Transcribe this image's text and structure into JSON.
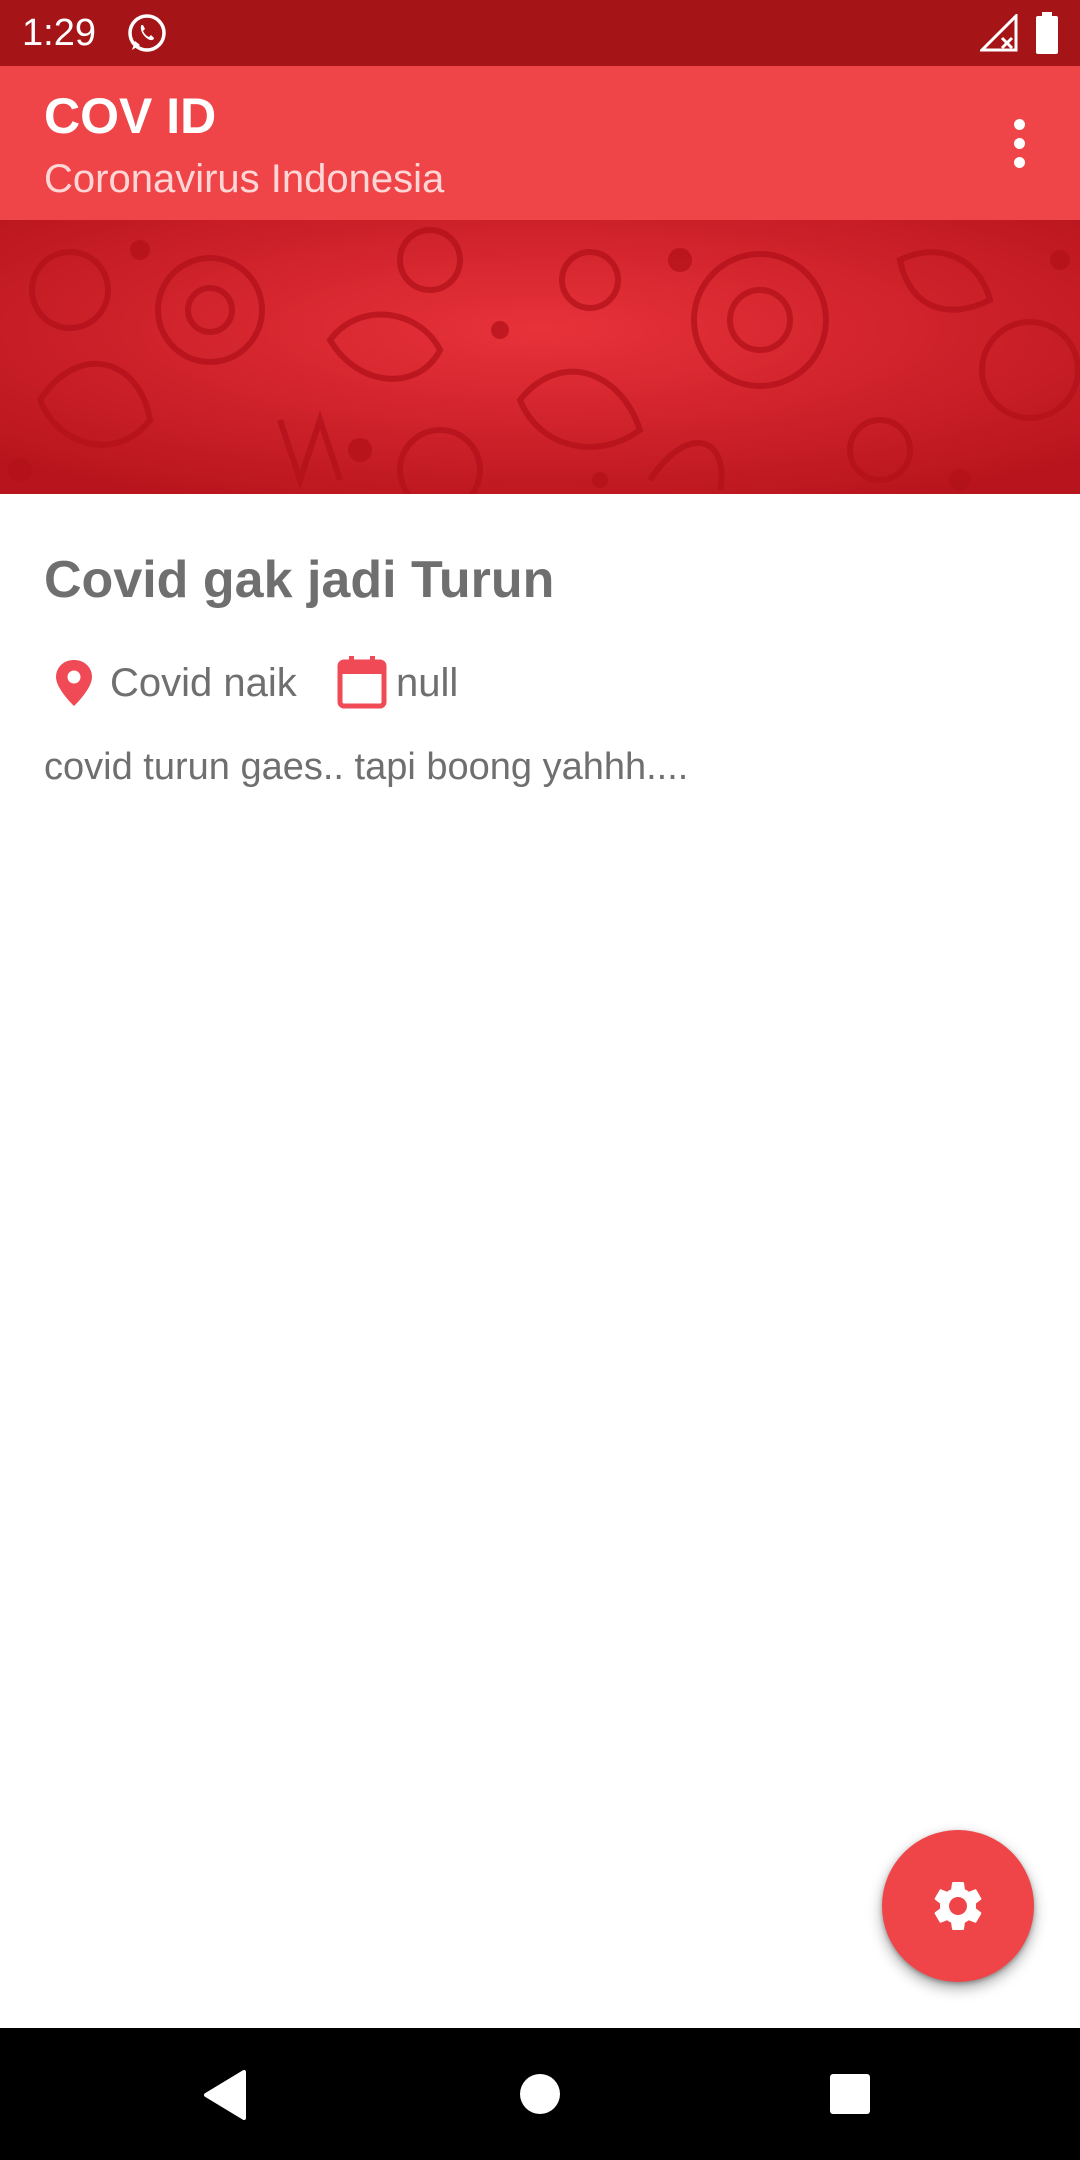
{
  "status_bar": {
    "time": "1:29",
    "icons": [
      "whatsapp-icon",
      "signal-icon",
      "battery-icon"
    ]
  },
  "app_bar": {
    "title": "COV ID",
    "subtitle": "Coronavirus Indonesia",
    "menu_icon": "more-vert-icon"
  },
  "post": {
    "title": "Covid gak jadi Turun",
    "location": "Covid naik",
    "date": "null",
    "body": "covid turun gaes.. tapi boong yahhh...."
  },
  "fab": {
    "icon": "gear-icon"
  },
  "nav_bar": {
    "icons": [
      "back-icon",
      "home-icon",
      "recents-icon"
    ]
  },
  "colors": {
    "status_bar": "#a51518",
    "app_bar": "#ef4548",
    "accent": "#ef4548",
    "banner": "#d42029",
    "text": "#6f6f6f"
  }
}
